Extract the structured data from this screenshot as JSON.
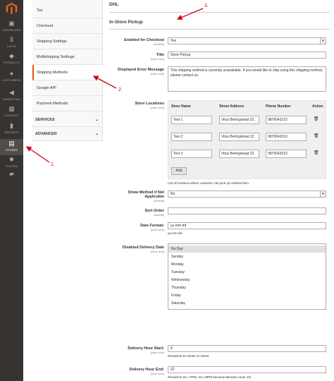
{
  "sidebar": {
    "items": [
      {
        "label": "DASHBOARD",
        "icon": "dashboard-icon",
        "glyph": "▣"
      },
      {
        "label": "SALES",
        "icon": "dollar-icon",
        "glyph": "$"
      },
      {
        "label": "PRODUCTS",
        "icon": "cube-icon",
        "glyph": "◆"
      },
      {
        "label": "CUSTOMERS",
        "icon": "user-icon",
        "glyph": "●"
      },
      {
        "label": "MARKETING",
        "icon": "megaphone-icon",
        "glyph": "◀"
      },
      {
        "label": "CONTENT",
        "icon": "layout-icon",
        "glyph": "▦"
      },
      {
        "label": "REPORTS",
        "icon": "bar-chart-icon",
        "glyph": "▮"
      },
      {
        "label": "STORES",
        "icon": "store-icon",
        "glyph": "▤"
      },
      {
        "label": "SYSTEM",
        "icon": "gear-icon",
        "glyph": "✹"
      },
      {
        "label": "",
        "icon": "extension-icon",
        "glyph": "▰"
      }
    ]
  },
  "config_nav": {
    "items": [
      "Tax",
      "Checkout",
      "Shipping Settings",
      "Multishipping Settings",
      "Shipping Methods",
      "Google API",
      "Payment Methods"
    ],
    "groups": [
      "SERVICES",
      "ADVANCED"
    ]
  },
  "sections": {
    "dhl": "DHL",
    "pickup": "In-Store Pickup"
  },
  "fields": {
    "enabled": {
      "label": "Enabled for Checkout",
      "scope": "[website]",
      "value": "Yes"
    },
    "title": {
      "label": "Title",
      "scope": "[store view]",
      "value": "Store Pickup"
    },
    "error": {
      "label": "Displayed Error Message",
      "scope": "[store view]",
      "value": "This shipping method is currently unavailable. If you would like to ship using this shipping method, please contact us."
    },
    "locations": {
      "label": "Store Locations",
      "scope": "[store view]",
      "headers": [
        "Store Name",
        "Street Address",
        "Phone Number",
        "Action"
      ],
      "rows": [
        {
          "name": "Test 1",
          "street": "Vitus Beringstraat 22,",
          "phone": "9876543210"
        },
        {
          "name": "Test 2",
          "street": "Vitus Beringstraat 22,",
          "phone": "9876543210"
        },
        {
          "name": "Test 3",
          "street": "Vitus Beringstraat 22,",
          "phone": "9876543210"
        }
      ],
      "add_label": "Add",
      "note": "List of locations where customer can pick up ordered item."
    },
    "show_method": {
      "label": "Show Method if Not Applicable",
      "scope": "[website]",
      "value": "No"
    },
    "sort_order": {
      "label": "Sort Order",
      "scope": "[website]",
      "value": ""
    },
    "date_format": {
      "label": "Date Format:",
      "scope": "[store view]",
      "value": "yy-mm-dd",
      "note": "yy-mm-dd"
    },
    "disabled_days": {
      "label": "Disabled Delivery Date",
      "scope": "[store view]",
      "options": [
        "No Day",
        "Sunday",
        "Monday",
        "Tuesday",
        "Wednesday",
        "Thursday",
        "Friday",
        "Saturday"
      ]
    },
    "hour_start": {
      "label": "Delivery Hour Start:",
      "scope": "[store view]",
      "value": "8",
      "note": "Should be 8=>8AM, 9=>9AM"
    },
    "hour_end": {
      "label": "Delivery Hour End:",
      "scope": "[store view]",
      "value": "22",
      "note": "Should be 22=>7PM, 23=>8PM because Minutes cover 1hr"
    }
  },
  "annotations": {
    "a1": "1.",
    "a2": "2.",
    "a3": "3."
  },
  "colors": {
    "sidebar": "#373330",
    "accent": "#eb5202",
    "arrow": "#d0021b"
  }
}
